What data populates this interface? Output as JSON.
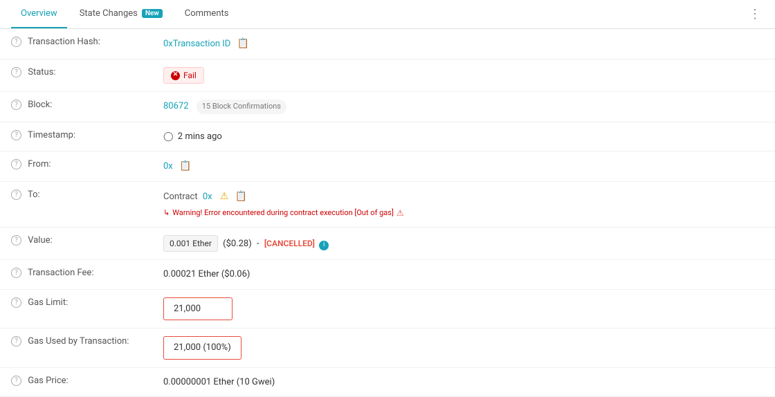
{
  "tabs": [
    {
      "id": "overview",
      "label": "Overview",
      "active": true,
      "badge": null
    },
    {
      "id": "state-changes",
      "label": "State Changes",
      "active": false,
      "badge": "New"
    },
    {
      "id": "comments",
      "label": "Comments",
      "active": false,
      "badge": null
    }
  ],
  "fields": {
    "transaction_hash": {
      "label": "Transaction Hash:",
      "value": "0xTransaction ID"
    },
    "status": {
      "label": "Status:",
      "value": "Fail"
    },
    "block": {
      "label": "Block:",
      "block_number": "80672",
      "confirmations": "15 Block Confirmations"
    },
    "timestamp": {
      "label": "Timestamp:",
      "value": "2 mins ago"
    },
    "from": {
      "label": "From:",
      "value": "0x"
    },
    "to": {
      "label": "To:",
      "contract_label": "Contract",
      "contract_address": "0x",
      "warning": "Warning! Error encountered during contract execution [Out of gas]"
    },
    "value": {
      "label": "Value:",
      "ether_amount": "0.001 Ether",
      "usd_amount": "($0.28)",
      "cancelled_label": "[CANCELLED]"
    },
    "transaction_fee": {
      "label": "Transaction Fee:",
      "value": "0.00021 Ether ($0.06)"
    },
    "gas_limit": {
      "label": "Gas Limit:",
      "value": "21,000"
    },
    "gas_used": {
      "label": "Gas Used by Transaction:",
      "value": "21,000 (100%)"
    },
    "gas_price": {
      "label": "Gas Price:",
      "value": "0.00000001 Ether (10 Gwei)"
    }
  }
}
